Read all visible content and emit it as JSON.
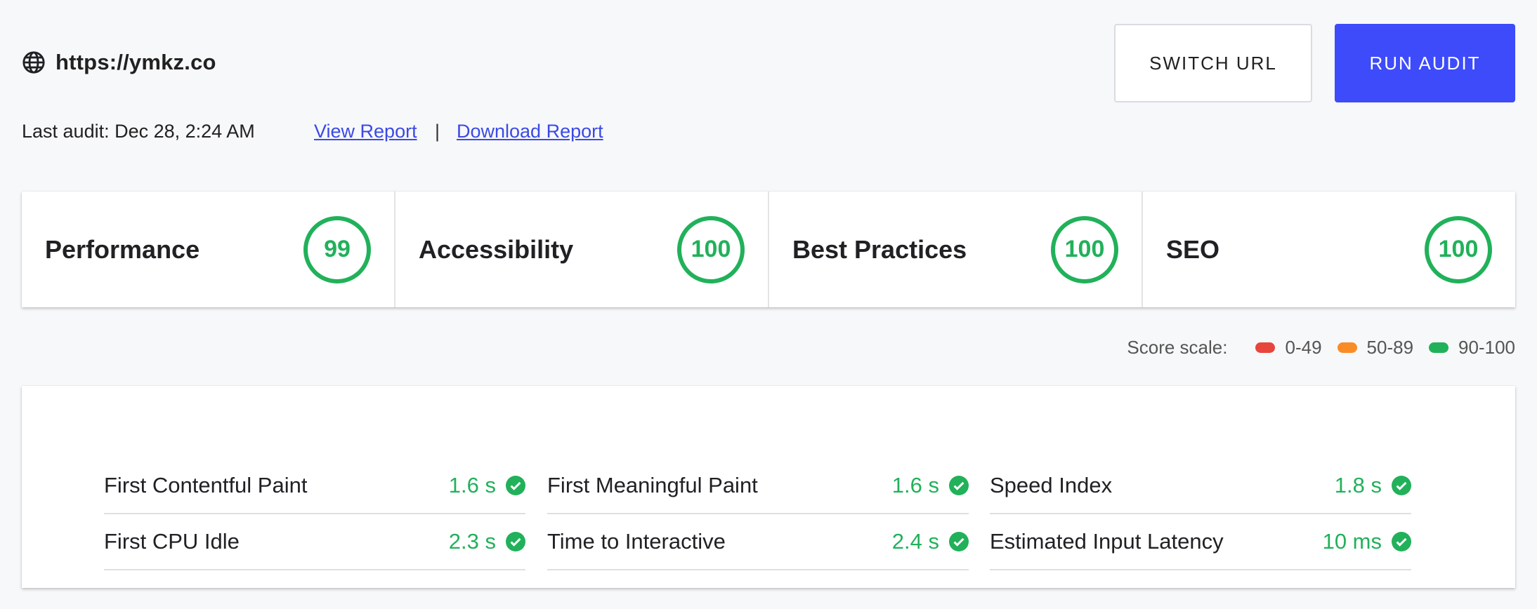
{
  "header": {
    "url": "https://ymkz.co",
    "url_icon": "globe-icon",
    "switch_url_label": "SWITCH URL",
    "run_audit_label": "RUN AUDIT",
    "last_audit": "Last audit: Dec 28, 2:24 AM",
    "view_report_label": "View Report ",
    "separator": "|",
    "download_report_label": "Download Report"
  },
  "scores": [
    {
      "label": "Performance",
      "value": "99"
    },
    {
      "label": "Accessibility",
      "value": "100"
    },
    {
      "label": "Best Practices",
      "value": "100"
    },
    {
      "label": "SEO",
      "value": "100"
    }
  ],
  "score_scale": {
    "title": "Score scale:",
    "ranges": [
      {
        "label": "0-49",
        "color": "#e8453c"
      },
      {
        "label": "50-89",
        "color": "#fa8c26"
      },
      {
        "label": "90-100",
        "color": "#21b15a"
      }
    ]
  },
  "metrics": [
    {
      "label": "First Contentful Paint",
      "value": "1.6 s"
    },
    {
      "label": "First Meaningful Paint",
      "value": "1.6 s"
    },
    {
      "label": "Speed Index",
      "value": "1.8 s"
    },
    {
      "label": "First CPU Idle",
      "value": "2.3 s"
    },
    {
      "label": "Time to Interactive",
      "value": "2.4 s"
    },
    {
      "label": "Estimated Input Latency",
      "value": "10 ms"
    }
  ],
  "colors": {
    "accent": "#3d4bfa",
    "pass": "#21b15a",
    "link": "#3b4ae6"
  }
}
